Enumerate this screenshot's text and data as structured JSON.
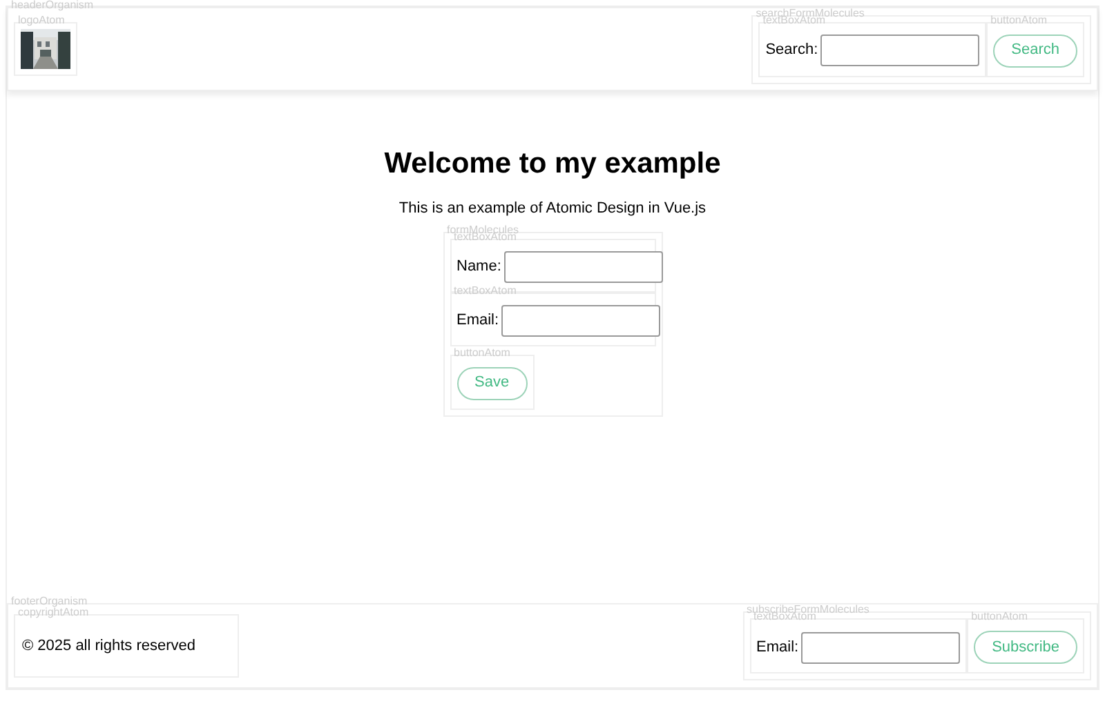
{
  "header": {
    "label": "headerOrganism",
    "logo": {
      "label": "logoAtom",
      "kind": "picture"
    },
    "search_form": {
      "label": "searchFormMolecules",
      "text_box": {
        "label": "textBoxAtom",
        "field_label": "Search:"
      },
      "button": {
        "label": "buttonAtom",
        "text": "Search"
      }
    }
  },
  "main": {
    "heading": "Welcome to my example",
    "intro": "This is an example of Atomic Design in Vue.js",
    "form": {
      "label": "formMolecules",
      "fields": [
        {
          "label": "textBoxAtom",
          "field_label": "Name:"
        },
        {
          "label": "textBoxAtom",
          "field_label": "Email:"
        }
      ],
      "button": {
        "label": "buttonAtom",
        "text": "Save"
      }
    }
  },
  "footer": {
    "label": "footerOrganism",
    "copyright": {
      "label": "copyrightAtom",
      "text": "© 2025 all rights reserved"
    },
    "subscribe_form": {
      "label": "subscribeFormMolecules",
      "text_box": {
        "label": "textBoxAtom",
        "field_label": "Email:"
      },
      "button": {
        "label": "buttonAtom",
        "text": "Subscribe"
      }
    }
  }
}
